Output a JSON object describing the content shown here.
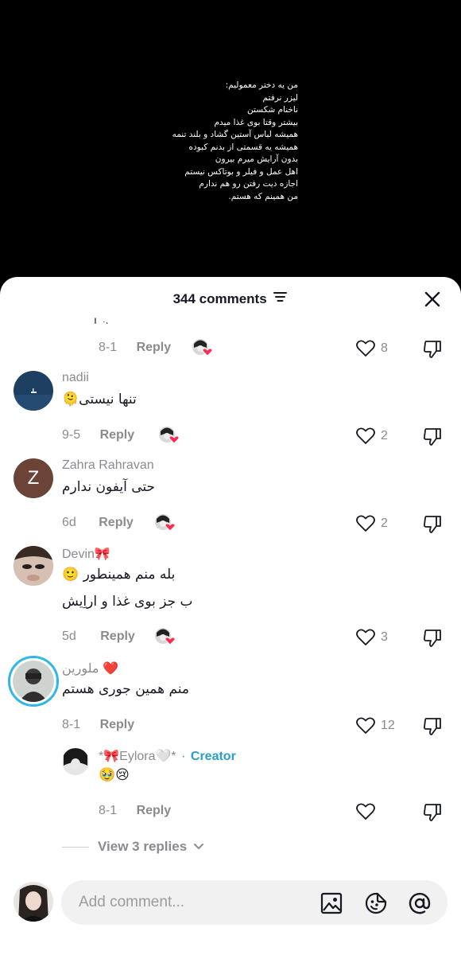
{
  "video": {
    "lines": [
      "من یه دختر معمولیم:",
      "لیزر نرفتم",
      "ناخنام شکستن",
      "بیشتر وقتا بوی غذا میدم",
      "همیشه لباس آستین گشاد و بلند تنمه",
      "همیشه یه قسمتی از بدنم کبوده",
      "بدون آرایش میرم بیرون",
      "اهل عمل و فیلر و بوتاکس نیستم",
      "اجازه دیت رفتن رو هم ندارم",
      "من همینم که هستم."
    ]
  },
  "header": {
    "count_label": "344 comments",
    "sort_icon": "sort-icon",
    "close_icon": "close-icon"
  },
  "comments": [
    {
      "partial": "ن ا",
      "date": "8-1",
      "reply": "Reply",
      "likes": "8"
    },
    {
      "user": "nadii",
      "text": "تنها نیستی🫠",
      "date": "9-5",
      "reply": "Reply",
      "likes": "2"
    },
    {
      "user": "Zahra Rahravan",
      "avatar_letter": "Z",
      "text": "حتی آیفون ندارم",
      "date": "6d",
      "reply": "Reply",
      "likes": "2"
    },
    {
      "user": "Devin🎀",
      "text": "بله منم همینطور 🙂",
      "text2": "ب جز بوی غذا و اراِیش",
      "date": "5d",
      "reply": "Reply",
      "likes": "3"
    },
    {
      "user": "ملورین ❤️",
      "text": "منم همین جوری هستم",
      "date": "8-1",
      "reply": "Reply",
      "likes": "12"
    }
  ],
  "reply": {
    "user": "*🎀Eylora🤍*",
    "dot": "·",
    "badge": "Creator",
    "text": "🥹😢",
    "date": "8-1",
    "reply": "Reply",
    "likes": ""
  },
  "view_replies": "View 3 replies",
  "composer": {
    "placeholder": "Add comment...",
    "icons": [
      "image-icon",
      "sticker-icon",
      "mention-icon"
    ]
  },
  "colors": {
    "accent": "#2a9fc7",
    "text": "#161823",
    "muted": "#8a8b91",
    "heart": "#fe2c55"
  }
}
